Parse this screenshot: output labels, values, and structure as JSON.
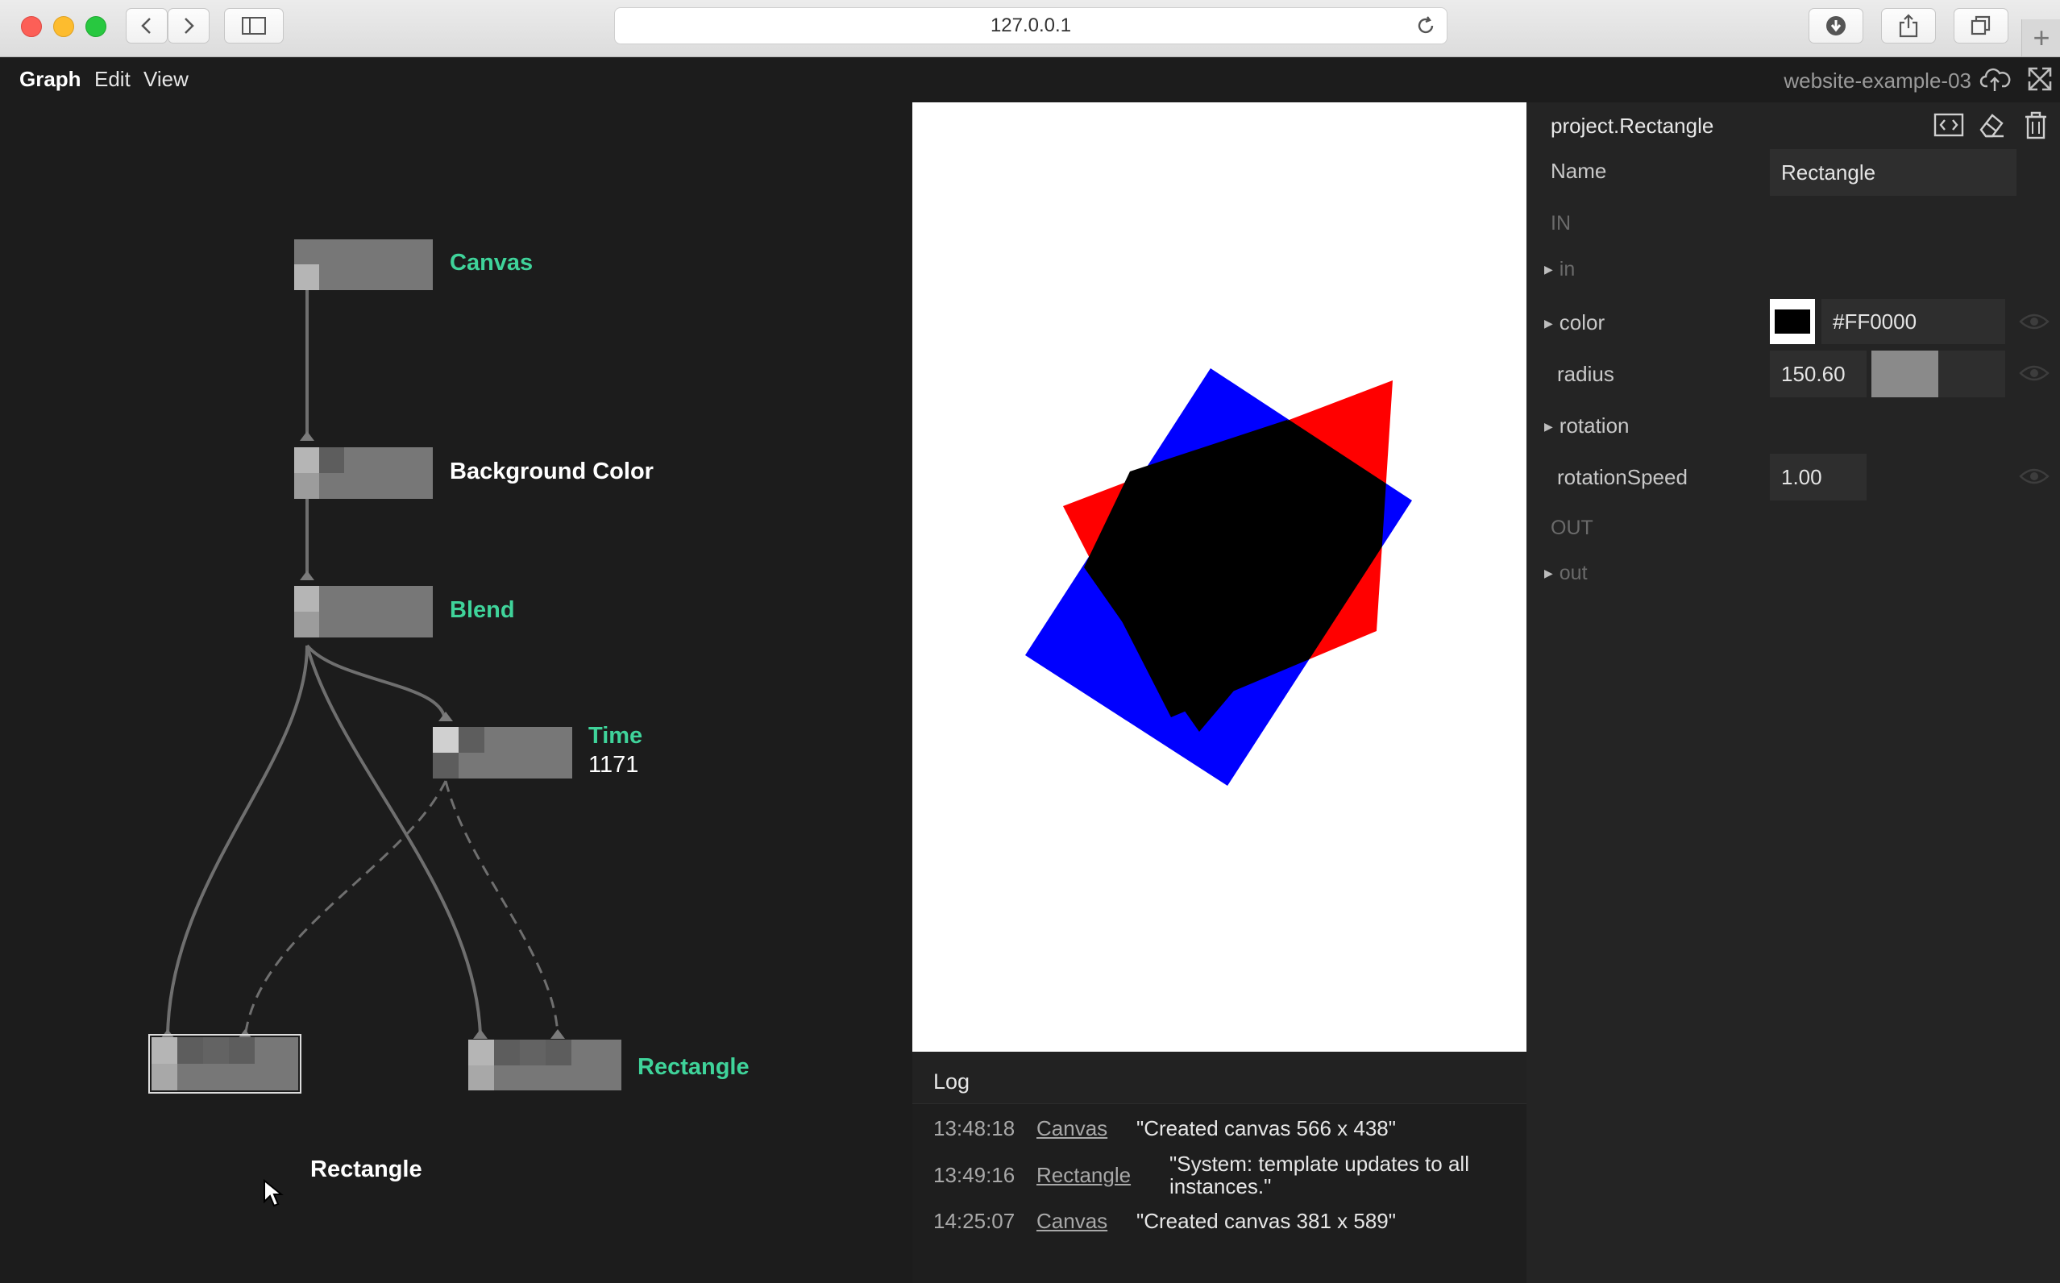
{
  "browser": {
    "url": "127.0.0.1",
    "icons": [
      "back-icon",
      "forward-icon",
      "sidebar-icon",
      "reload-icon",
      "download-icon",
      "share-icon",
      "tabs-icon",
      "new-tab-icon"
    ]
  },
  "menubar": {
    "items": [
      "Graph",
      "Edit",
      "View"
    ],
    "project_name": "website-example-03",
    "icons": [
      "cloud-upload-icon",
      "fullscreen-icon"
    ]
  },
  "graph": {
    "nodes": [
      {
        "label": "Canvas",
        "style": "green"
      },
      {
        "label": "Background Color",
        "style": "white"
      },
      {
        "label": "Blend",
        "style": "green"
      },
      {
        "label": "Time",
        "value": "1171",
        "style": "green"
      },
      {
        "label": "Rectangle",
        "style": "white",
        "selected": true
      },
      {
        "label": "Rectangle",
        "style": "green"
      }
    ]
  },
  "viewer": {
    "shapes": [
      {
        "kind": "square",
        "fill": "#0000FF",
        "rotation_deg": 35
      },
      {
        "kind": "square",
        "fill": "#FF0000",
        "rotation_deg": -20
      },
      {
        "kind": "overlap",
        "fill": "#000000"
      }
    ]
  },
  "log": {
    "title": "Log",
    "entries": [
      {
        "time": "13:48:18",
        "source": "Canvas",
        "message": "\"Created canvas 566 x 438\""
      },
      {
        "time": "13:49:16",
        "source": "Rectangle",
        "message": "\"System: template updates to all instances.\""
      },
      {
        "time": "14:25:07",
        "source": "Canvas",
        "message": "\"Created canvas 381 x 589\""
      }
    ]
  },
  "inspector": {
    "title": "project.Rectangle",
    "icons": [
      "code-icon",
      "eraser-icon",
      "trash-icon"
    ],
    "name_label": "Name",
    "name_value": "Rectangle",
    "in_label": "IN",
    "in_port": "in",
    "color_label": "color",
    "color_value": "#FF0000",
    "radius_label": "radius",
    "radius_value": "150.60",
    "radius_slider_fraction": 0.5,
    "rotation_label": "rotation",
    "rotation_speed_label": "rotationSpeed",
    "rotation_speed_value": "1.00",
    "out_label": "OUT",
    "out_port": "out"
  }
}
